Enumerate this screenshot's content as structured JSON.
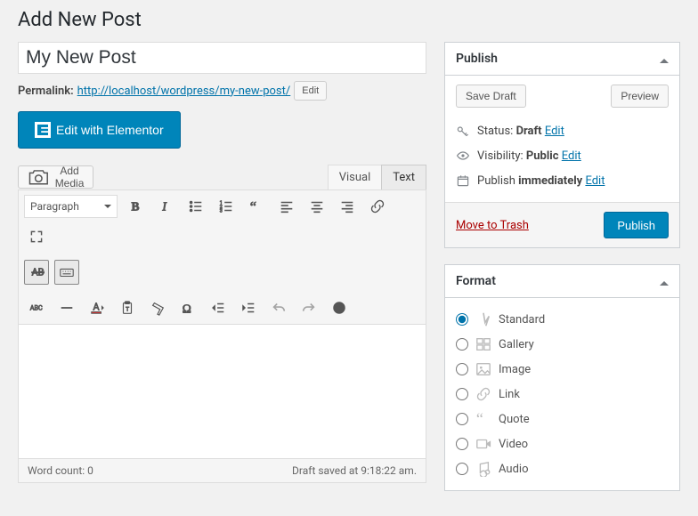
{
  "page_title": "Add New Post",
  "title_field": {
    "value": "My New Post"
  },
  "permalink": {
    "label": "Permalink:",
    "url": "http://localhost/wordpress/my-new-post/",
    "edit": "Edit"
  },
  "elementor_btn": "Edit with Elementor",
  "add_media": "Add Media",
  "tabs": {
    "visual": "Visual",
    "text": "Text"
  },
  "toolbar": {
    "block_format": "Paragraph"
  },
  "status_bar": {
    "word_count": "Word count: 0",
    "save_info": "Draft saved at 9:18:22 am."
  },
  "publish_panel": {
    "title": "Publish",
    "save_draft": "Save Draft",
    "preview": "Preview",
    "status_label": "Status:",
    "status_value": "Draft",
    "visibility_label": "Visibility:",
    "visibility_value": "Public",
    "schedule_label": "Publish",
    "schedule_value": "immediately",
    "edit": "Edit",
    "trash": "Move to Trash",
    "publish_btn": "Publish"
  },
  "format_panel": {
    "title": "Format",
    "items": [
      {
        "label": "Standard",
        "checked": true
      },
      {
        "label": "Gallery",
        "checked": false
      },
      {
        "label": "Image",
        "checked": false
      },
      {
        "label": "Link",
        "checked": false
      },
      {
        "label": "Quote",
        "checked": false
      },
      {
        "label": "Video",
        "checked": false
      },
      {
        "label": "Audio",
        "checked": false
      }
    ]
  }
}
